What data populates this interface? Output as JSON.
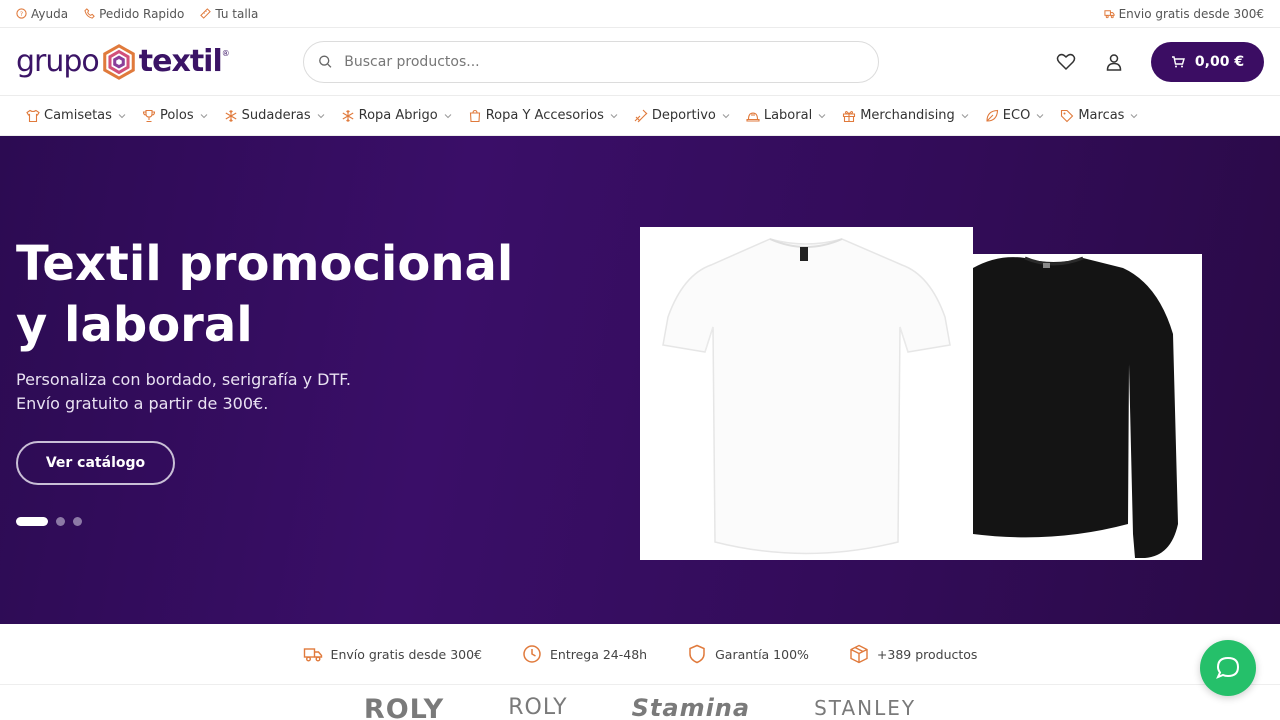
{
  "topbar": {
    "help": "Ayuda",
    "quick_order": "Pedido Rapido",
    "size": "Tu talla",
    "shipping": "Envio gratis desde 300€"
  },
  "header": {
    "logo_left": "grupo",
    "logo_right": "textil",
    "logo_reg": "®",
    "search_placeholder": "Buscar productos...",
    "cart_total": "0,00 €"
  },
  "nav": {
    "items": [
      {
        "label": "Camisetas",
        "icon": "tshirt-icon"
      },
      {
        "label": "Polos",
        "icon": "trophy-icon"
      },
      {
        "label": "Sudaderas",
        "icon": "snowflake-icon"
      },
      {
        "label": "Ropa Abrigo",
        "icon": "snowflake-icon"
      },
      {
        "label": "Ropa Y Accesorios",
        "icon": "bag-icon"
      },
      {
        "label": "Deportivo",
        "icon": "sport-icon"
      },
      {
        "label": "Laboral",
        "icon": "helmet-icon"
      },
      {
        "label": "Merchandising",
        "icon": "gift-icon"
      },
      {
        "label": "ECO",
        "icon": "leaf-icon"
      },
      {
        "label": "Marcas",
        "icon": "tag-icon"
      }
    ]
  },
  "hero": {
    "title_line1": "Textil promocional",
    "title_line2": "y laboral",
    "subtitle_line1": "Personaliza con bordado, serigrafía y DTF.",
    "subtitle_line2": "Envío gratuito a partir de 300€.",
    "cta": "Ver catálogo",
    "slides": 3,
    "active_slide": 1
  },
  "features": [
    {
      "label": "Envío gratis desde 300€",
      "icon": "truck-icon"
    },
    {
      "label": "Entrega 24-48h",
      "icon": "clock-icon"
    },
    {
      "label": "Garantía 100%",
      "icon": "shield-icon"
    },
    {
      "label": "+389 productos",
      "icon": "box-icon"
    }
  ],
  "brands": [
    "ROLY",
    "ROLY",
    "Stamina",
    "STANLEY"
  ],
  "colors": {
    "brand_purple": "#3b0d63",
    "accent_orange": "#e07a3c",
    "chat_green": "#25c06a"
  }
}
